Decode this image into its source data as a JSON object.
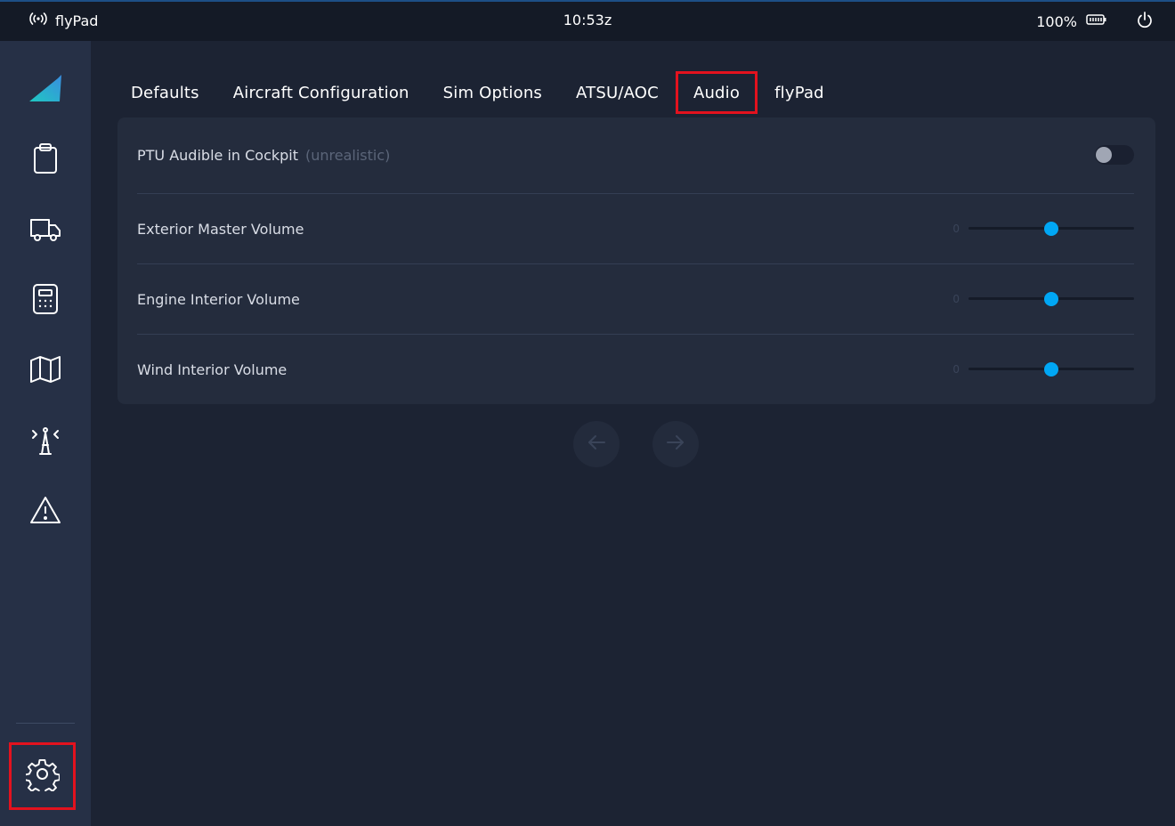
{
  "statusbar": {
    "app_name": "flyPad",
    "time": "10:53z",
    "battery": "100%",
    "icons": [
      "wifi-icon",
      "battery-icon",
      "power-icon"
    ]
  },
  "sidebar": {
    "items": [
      {
        "name": "logo",
        "icon": "flybywire-logo"
      },
      {
        "name": "dispatch",
        "icon": "clipboard-icon"
      },
      {
        "name": "ground",
        "icon": "truck-icon"
      },
      {
        "name": "performance",
        "icon": "calculator-icon"
      },
      {
        "name": "navigation",
        "icon": "map-icon"
      },
      {
        "name": "atc",
        "icon": "broadcast-tower-icon"
      },
      {
        "name": "failures",
        "icon": "warning-icon"
      },
      {
        "name": "settings",
        "icon": "gear-icon"
      }
    ],
    "active": "settings"
  },
  "tabs": [
    {
      "label": "Defaults"
    },
    {
      "label": "Aircraft Configuration"
    },
    {
      "label": "Sim Options"
    },
    {
      "label": "ATSU/AOC"
    },
    {
      "label": "Audio",
      "active": true
    },
    {
      "label": "flyPad"
    }
  ],
  "audio_settings": {
    "ptu": {
      "label": "PTU Audible in Cockpit",
      "note": "(unrealistic)",
      "enabled": false
    },
    "volumes": [
      {
        "label": "Exterior Master Volume",
        "min": "0",
        "value_fraction": 0.5
      },
      {
        "label": "Engine Interior Volume",
        "min": "0",
        "value_fraction": 0.5
      },
      {
        "label": "Wind Interior Volume",
        "min": "0",
        "value_fraction": 0.5
      }
    ]
  },
  "pagination": {
    "prev_icon": "arrow-left-icon",
    "next_icon": "arrow-right-icon"
  },
  "colors": {
    "accent": "#00a7f5",
    "highlight": "#e3121e",
    "background": "#1c2333",
    "sidebar": "#263046"
  }
}
